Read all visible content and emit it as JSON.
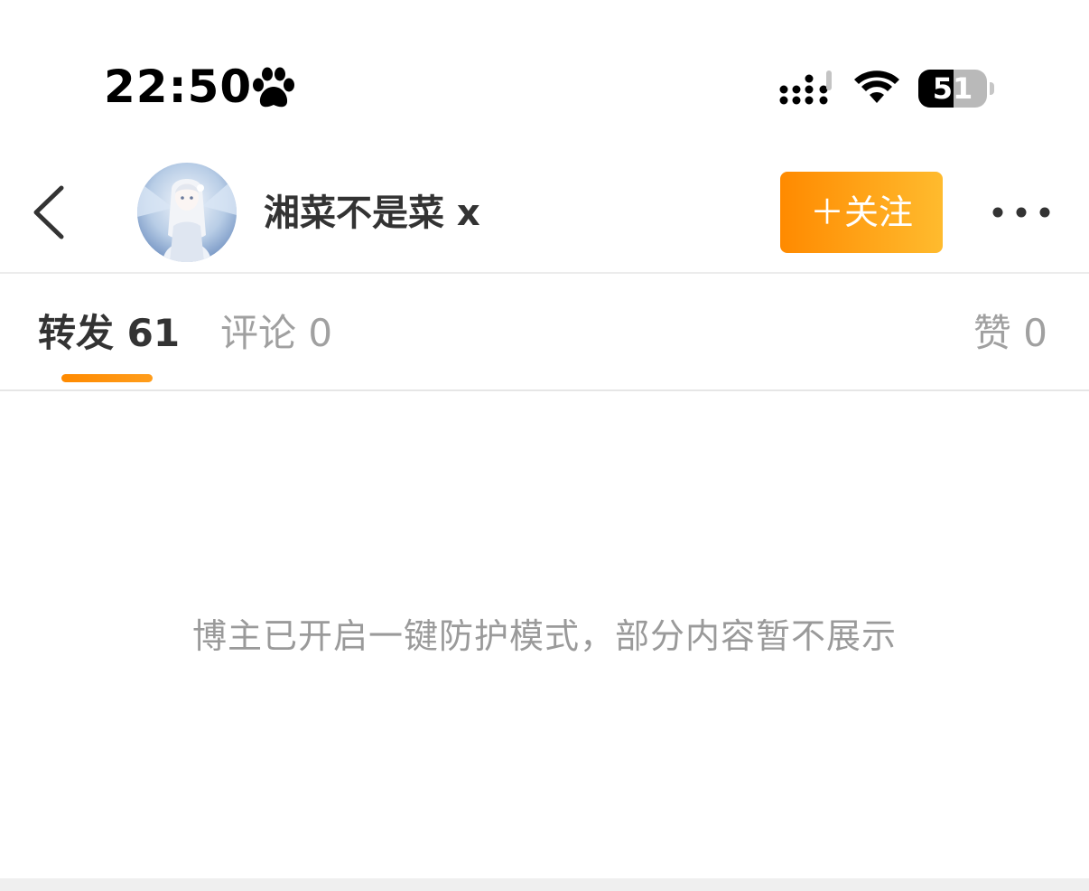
{
  "status_bar": {
    "time": "22:50",
    "status_icon": "paw-icon",
    "signal_icon": "cellular-signal-icon",
    "wifi_icon": "wifi-icon",
    "battery_level": "51",
    "battery_fraction": 0.51
  },
  "header": {
    "back_icon": "chevron-left-icon",
    "username": "湘菜不是菜 x",
    "follow_label": "＋关注",
    "more_icon": "more-horizontal-icon",
    "accent_gradient": [
      "#ff8a00",
      "#ffbb2e"
    ]
  },
  "tabs": [
    {
      "label": "转发 61",
      "active": true
    },
    {
      "label": "评论 0",
      "active": false
    },
    {
      "label": "赞 0",
      "active": false
    }
  ],
  "content": {
    "notice": "博主已开启一键防护模式，部分内容暂不展示"
  }
}
